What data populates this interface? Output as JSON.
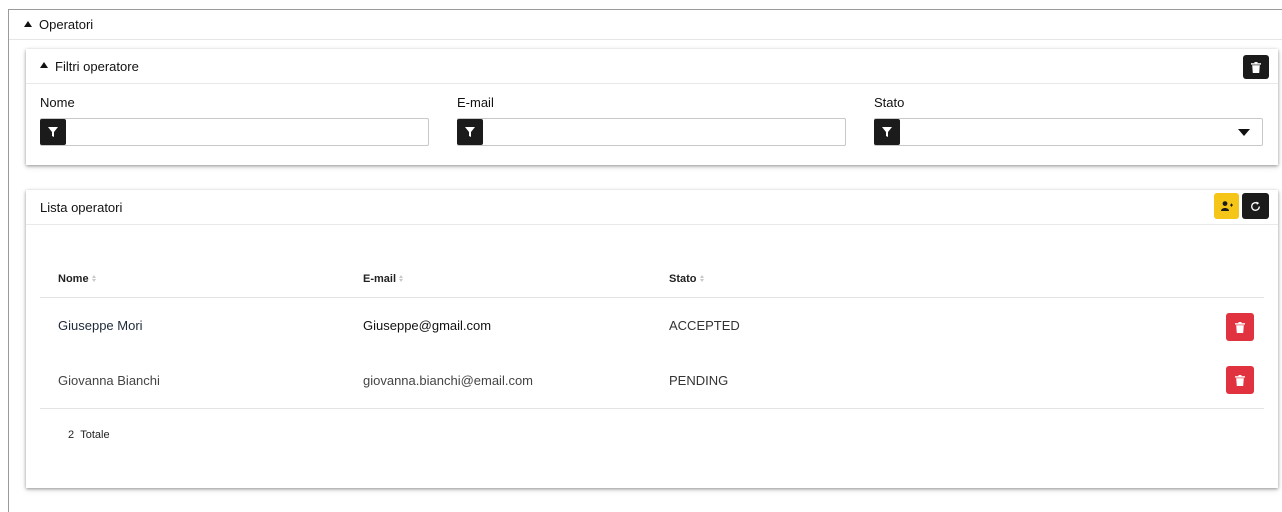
{
  "operators": {
    "title": "Operatori"
  },
  "filters": {
    "title": "Filtri operatore",
    "name_label": "Nome",
    "email_label": "E-mail",
    "status_label": "Stato",
    "name_value": "",
    "email_value": "",
    "status_value": "",
    "clear_icon": "trash-icon",
    "filter_icon": "filter-icon"
  },
  "list": {
    "title": "Lista operatori",
    "add_icon": "add-user-icon",
    "refresh_icon": "refresh-icon",
    "columns": [
      "Nome",
      "E-mail",
      "Stato"
    ],
    "rows": [
      {
        "name": "Giuseppe Mori",
        "email": "Giuseppe@gmail.com",
        "status": "ACCEPTED"
      },
      {
        "name": "Giovanna Bianchi",
        "email": "giovanna.bianchi@email.com",
        "status": "PENDING"
      }
    ],
    "total_count": "2",
    "total_label": "Totale"
  },
  "colors": {
    "primary_dark": "#1b1b1b",
    "accent_yellow": "#f5c518",
    "danger_red": "#e0333f"
  }
}
